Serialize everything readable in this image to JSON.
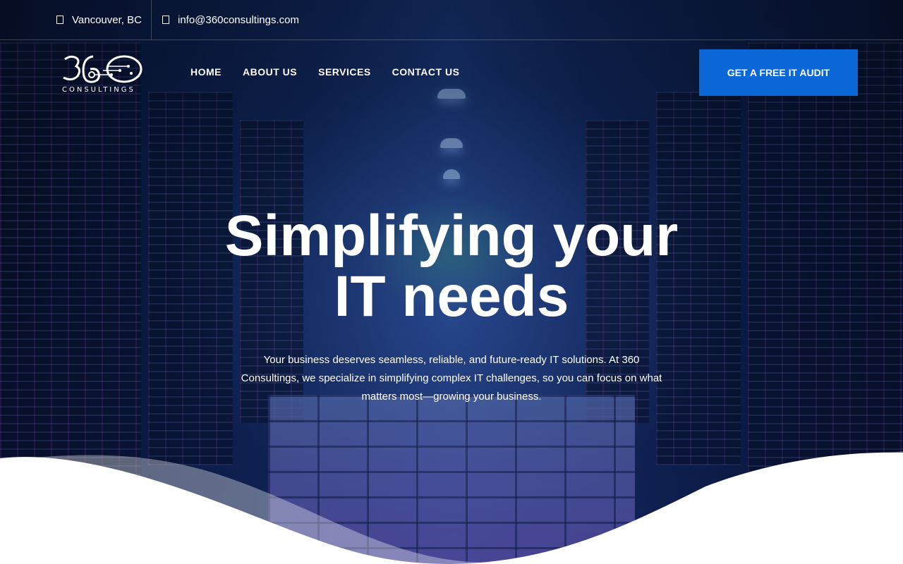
{
  "topbar": {
    "location": "Vancouver, BC",
    "email": "info@360consultings.com",
    "location_icon": "map-marker-icon",
    "email_icon": "envelope-icon"
  },
  "brand": {
    "logo_mark": "360",
    "logo_word": "CONSULTINGS"
  },
  "nav": {
    "items": [
      "HOME",
      "ABOUT US",
      "SERVICES",
      "CONTACT US"
    ]
  },
  "cta": {
    "label": "GET A FREE IT AUDIT"
  },
  "hero": {
    "title_line1": "Simplifying your",
    "title_line2": "IT needs",
    "subtitle": "Your business deserves seamless, reliable, and future-ready IT solutions. At 360 Consultings, we specialize in simplifying complex IT challenges, so you can focus on what matters most—growing your business."
  },
  "colors": {
    "accent": "#0b66d6",
    "text": "#ffffff",
    "background_dark": "#0b1c44"
  }
}
